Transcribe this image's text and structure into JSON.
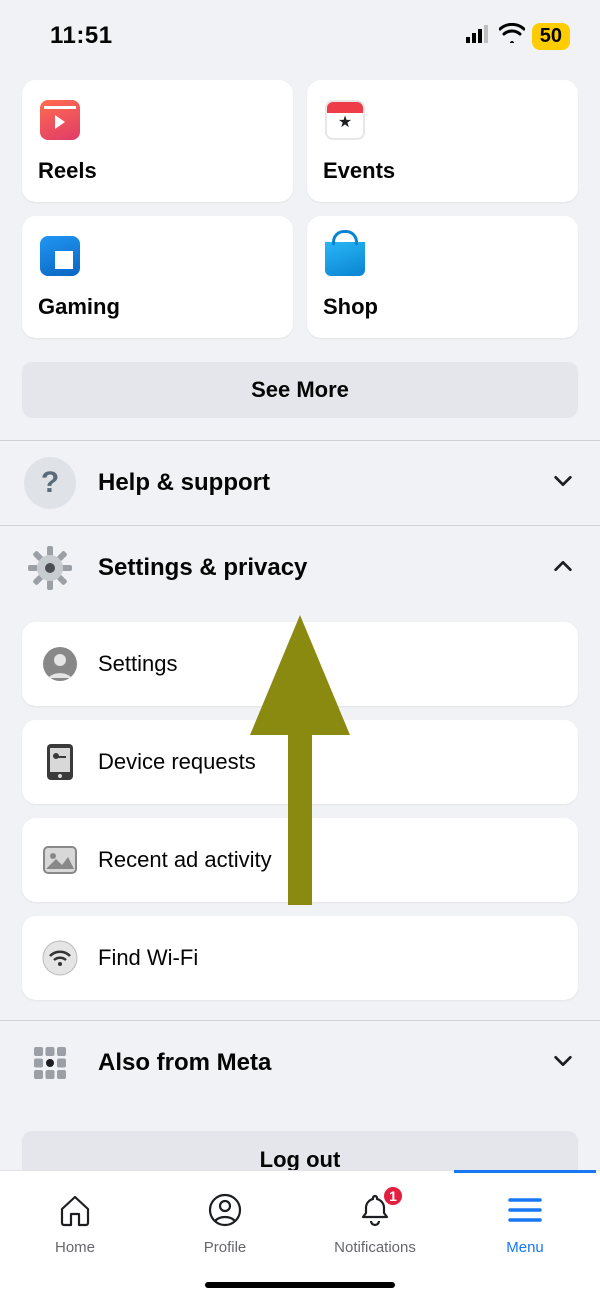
{
  "status": {
    "time": "11:51",
    "battery": "50"
  },
  "shortcuts": [
    {
      "label": "Reels"
    },
    {
      "label": "Events"
    },
    {
      "label": "Gaming"
    },
    {
      "label": "Shop"
    }
  ],
  "see_more_label": "See More",
  "sections": {
    "help": {
      "label": "Help & support",
      "expanded": false
    },
    "settings": {
      "label": "Settings & privacy",
      "expanded": true,
      "items": [
        {
          "label": "Settings"
        },
        {
          "label": "Device requests"
        },
        {
          "label": "Recent ad activity"
        },
        {
          "label": "Find Wi-Fi"
        }
      ]
    },
    "meta": {
      "label": "Also from Meta",
      "expanded": false
    }
  },
  "logout_label": "Log out",
  "tabs": {
    "home": "Home",
    "profile": "Profile",
    "notifications": "Notifications",
    "notifications_badge": "1",
    "menu": "Menu"
  },
  "colors": {
    "accent": "#1877f2",
    "badge_red": "#e41e3f",
    "battery_yellow": "#ffcc00",
    "arrow": "#8a8a10"
  }
}
